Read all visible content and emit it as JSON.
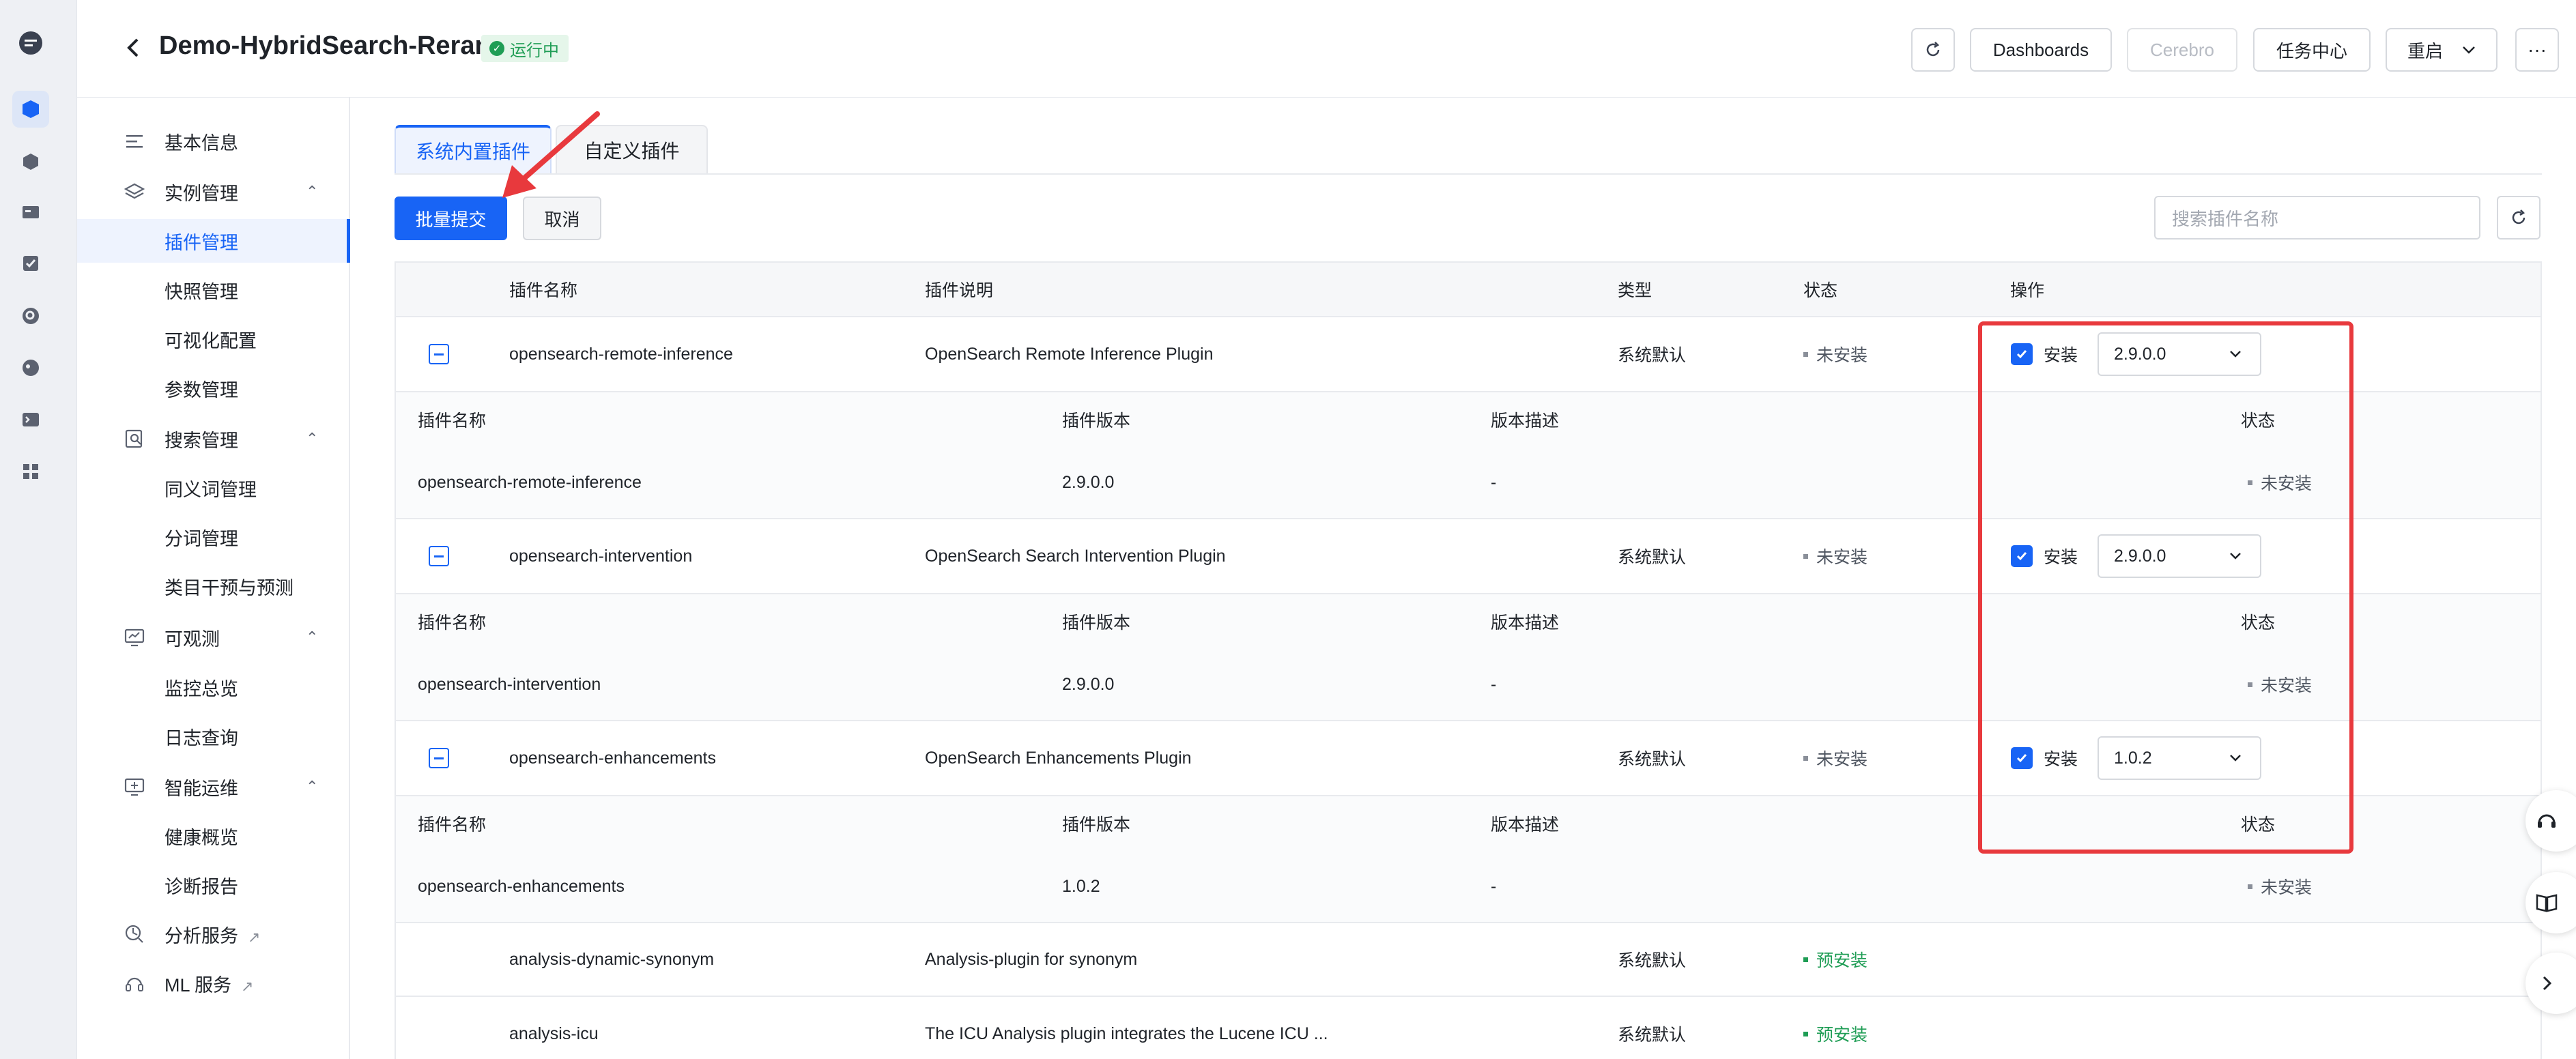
{
  "header": {
    "title": "Demo-HybridSearch-Rerank",
    "status_badge": "运行中",
    "buttons": {
      "dashboards": "Dashboards",
      "cerebro": "Cerebro",
      "task_center": "任务中心",
      "restart": "重启"
    }
  },
  "sidebar": {
    "basic_info": "基本信息",
    "instance_mgmt": "实例管理",
    "plugin_mgmt": "插件管理",
    "snapshot_mgmt": "快照管理",
    "visual_config": "可视化配置",
    "param_mgmt": "参数管理",
    "search_mgmt": "搜索管理",
    "synonym_mgmt": "同义词管理",
    "tokenizer_mgmt": "分词管理",
    "category_intervention": "类目干预与预测",
    "observability": "可观测",
    "monitor_overview": "监控总览",
    "log_query": "日志查询",
    "smart_ops": "智能运维",
    "health_overview": "健康概览",
    "diagnosis_report": "诊断报告",
    "analytics_service": "分析服务",
    "ml_service": "ML 服务"
  },
  "tabs": {
    "builtin": "系统内置插件",
    "custom": "自定义插件"
  },
  "actions": {
    "batch_submit": "批量提交",
    "cancel": "取消",
    "search_placeholder": "搜索插件名称"
  },
  "table": {
    "columns": {
      "name": "插件名称",
      "desc": "插件说明",
      "type": "类型",
      "status": "状态",
      "ops": "操作"
    },
    "sub_columns": {
      "name": "插件名称",
      "version": "插件版本",
      "version_desc": "版本描述",
      "status": "状态"
    },
    "install_label": "安装",
    "rows": [
      {
        "name": "opensearch-remote-inference",
        "desc": "OpenSearch Remote Inference Plugin",
        "type": "系统默认",
        "status": "未安装",
        "version": "2.9.0.0",
        "sub": {
          "name": "opensearch-remote-inference",
          "version": "2.9.0.0",
          "version_desc": "-",
          "status": "未安装"
        }
      },
      {
        "name": "opensearch-intervention",
        "desc": "OpenSearch Search Intervention Plugin",
        "type": "系统默认",
        "status": "未安装",
        "version": "2.9.0.0",
        "sub": {
          "name": "opensearch-intervention",
          "version": "2.9.0.0",
          "version_desc": "-",
          "status": "未安装"
        }
      },
      {
        "name": "opensearch-enhancements",
        "desc": "OpenSearch Enhancements Plugin",
        "type": "系统默认",
        "status": "未安装",
        "version": "1.0.2",
        "sub": {
          "name": "opensearch-enhancements",
          "version": "1.0.2",
          "version_desc": "-",
          "status": "未安装"
        }
      },
      {
        "name": "analysis-dynamic-synonym",
        "desc": "Analysis-plugin for synonym",
        "type": "系统默认",
        "status": "预安装"
      },
      {
        "name": "analysis-icu",
        "desc": "The ICU Analysis plugin integrates the Lucene ICU ...",
        "type": "系统默认",
        "status": "预安装"
      }
    ]
  },
  "colors": {
    "primary": "#1864f5",
    "annotation_red": "#e8393d",
    "status_green": "#1f9d55"
  }
}
